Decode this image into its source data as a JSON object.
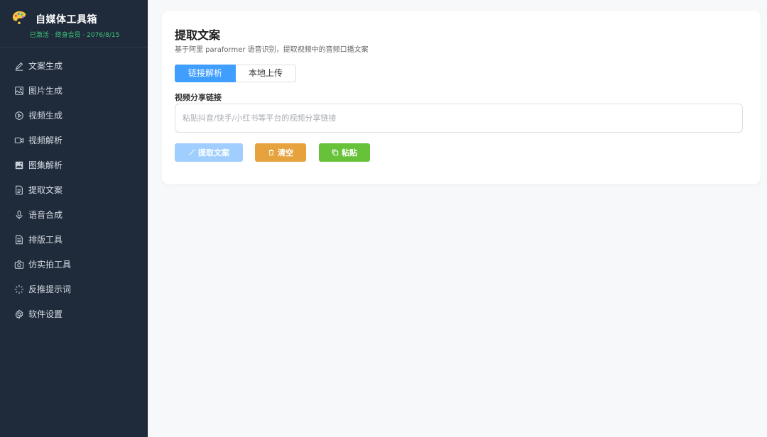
{
  "brand": {
    "title": "自媒体工具箱",
    "subtitle": "已激活 · 终身会员 · 2076/8/15"
  },
  "sidebar": {
    "items": [
      {
        "label": "文案生成",
        "icon": "pen-icon"
      },
      {
        "label": "图片生成",
        "icon": "image-icon"
      },
      {
        "label": "视频生成",
        "icon": "play-circle-icon"
      },
      {
        "label": "视频解析",
        "icon": "video-camera-icon"
      },
      {
        "label": "图集解析",
        "icon": "gallery-icon"
      },
      {
        "label": "提取文案",
        "icon": "document-icon"
      },
      {
        "label": "语音合成",
        "icon": "microphone-icon"
      },
      {
        "label": "排版工具",
        "icon": "layout-doc-icon"
      },
      {
        "label": "仿实拍工具",
        "icon": "camera-icon"
      },
      {
        "label": "反推提示词",
        "icon": "sparkle-icon"
      },
      {
        "label": "软件设置",
        "icon": "gear-icon"
      }
    ]
  },
  "main": {
    "title": "提取文案",
    "description": "基于阿里 paraformer 语音识别，提取视频中的音频口播文案",
    "tabs": [
      {
        "label": "链接解析",
        "active": true
      },
      {
        "label": "本地上传",
        "active": false
      }
    ],
    "field_label": "视频分享链接",
    "input": {
      "value": "",
      "placeholder": "粘贴抖音/快手/小红书等平台的视频分享链接"
    },
    "buttons": {
      "extract": "提取文案",
      "clear": "清空",
      "paste": "粘贴"
    }
  },
  "colors": {
    "sidebar_bg": "#1f2a3a",
    "primary": "#409eff",
    "primary_disabled": "#a0cfff",
    "warning": "#e6a23c",
    "success": "#67c23a",
    "status_green": "#3ec87a"
  }
}
